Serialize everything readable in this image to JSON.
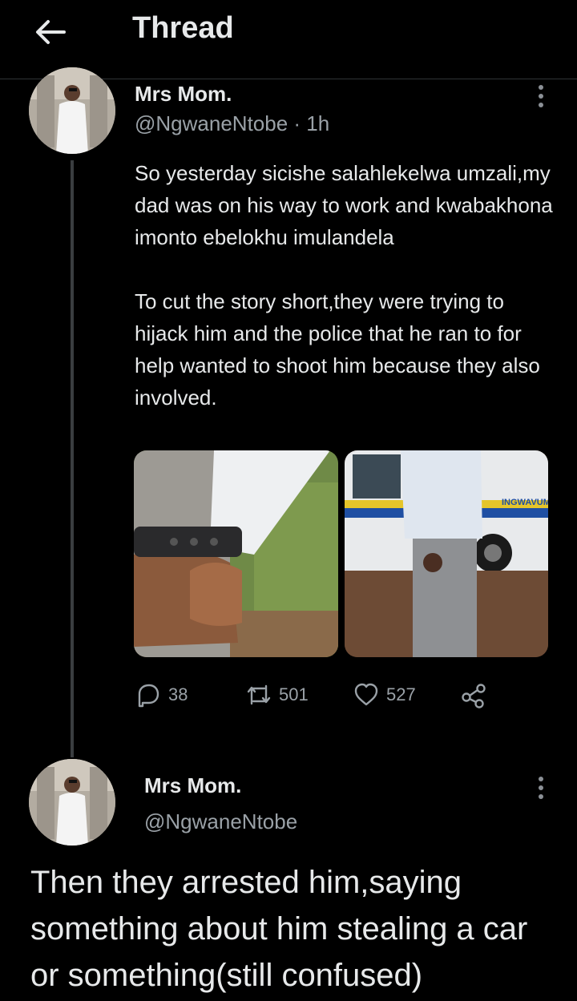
{
  "header": {
    "title": "Thread"
  },
  "tweet": {
    "name": "Mrs Mom.",
    "handle": "@NgwaneNtobe",
    "time": "· 1h",
    "text": "So yesterday sicishe salahlekelwa umzali,my dad was on his way to work and kwabakhona imonto ebelokhu imulandela\n\nTo cut the story short,they were trying to hijack him and the police that he ran to for help wanted to shoot him because they also involved.",
    "replies": "38",
    "retweets": "501",
    "likes": "527",
    "vehicle_text": "INGWAVUMA"
  },
  "reply": {
    "name": "Mrs Mom.",
    "handle": "@NgwaneNtobe",
    "text": "Then they arrested him,saying something about him stealing a car or something(still confused)"
  },
  "colors": {
    "background": "#000000",
    "text": "#e7e9ea",
    "muted": "#9aa1a7",
    "divider": "#2f3336"
  }
}
